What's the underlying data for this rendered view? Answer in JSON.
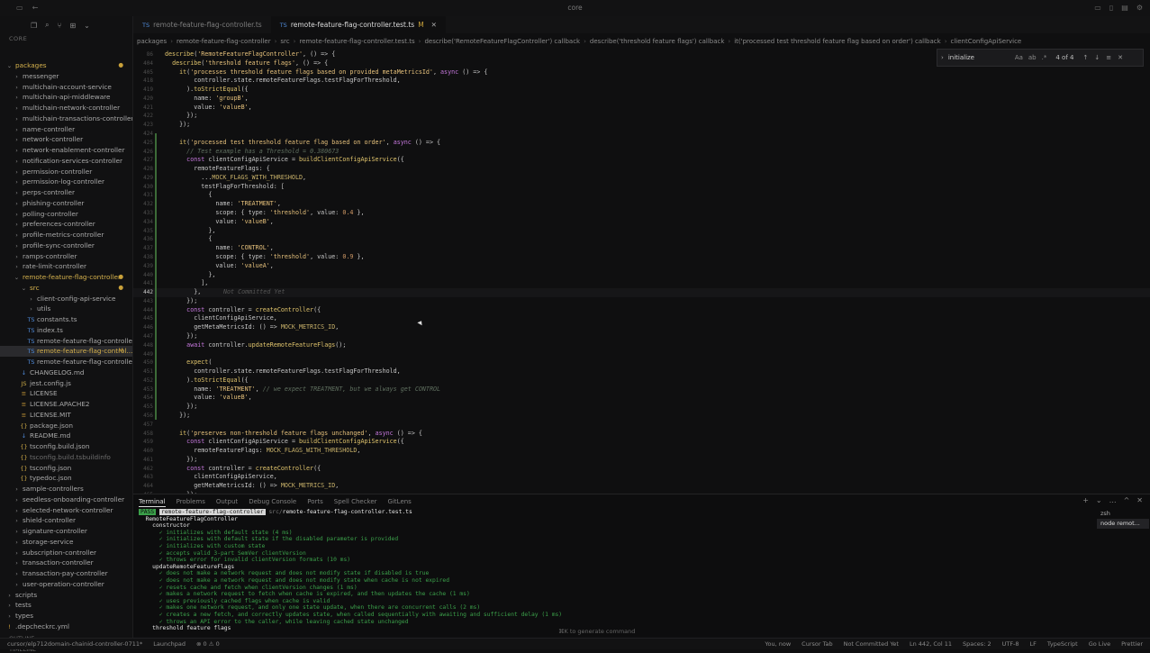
{
  "window": {
    "title": "core"
  },
  "sidebar": {
    "section_label": "CORE",
    "outline_label": "OUTLINE",
    "timeline_label": "TIMELINE",
    "items": [
      {
        "label": "packages",
        "depth": 0,
        "kind": "folder-open",
        "mod": true,
        "badge": "●"
      },
      {
        "label": "messenger",
        "depth": 1,
        "kind": "folder",
        "mod": false
      },
      {
        "label": "multichain-account-service",
        "depth": 1,
        "kind": "folder",
        "mod": false
      },
      {
        "label": "multichain-api-middleware",
        "depth": 1,
        "kind": "folder",
        "mod": false
      },
      {
        "label": "multichain-network-controller",
        "depth": 1,
        "kind": "folder",
        "mod": false
      },
      {
        "label": "multichain-transactions-controller",
        "depth": 1,
        "kind": "folder",
        "mod": false
      },
      {
        "label": "name-controller",
        "depth": 1,
        "kind": "folder",
        "mod": false
      },
      {
        "label": "network-controller",
        "depth": 1,
        "kind": "folder",
        "mod": false
      },
      {
        "label": "network-enablement-controller",
        "depth": 1,
        "kind": "folder",
        "mod": false
      },
      {
        "label": "notification-services-controller",
        "depth": 1,
        "kind": "folder",
        "mod": false
      },
      {
        "label": "permission-controller",
        "depth": 1,
        "kind": "folder",
        "mod": false
      },
      {
        "label": "permission-log-controller",
        "depth": 1,
        "kind": "folder",
        "mod": false
      },
      {
        "label": "perps-controller",
        "depth": 1,
        "kind": "folder",
        "mod": false
      },
      {
        "label": "phishing-controller",
        "depth": 1,
        "kind": "folder",
        "mod": false
      },
      {
        "label": "polling-controller",
        "depth": 1,
        "kind": "folder",
        "mod": false
      },
      {
        "label": "preferences-controller",
        "depth": 1,
        "kind": "folder",
        "mod": false
      },
      {
        "label": "profile-metrics-controller",
        "depth": 1,
        "kind": "folder",
        "mod": false
      },
      {
        "label": "profile-sync-controller",
        "depth": 1,
        "kind": "folder",
        "mod": false
      },
      {
        "label": "ramps-controller",
        "depth": 1,
        "kind": "folder",
        "mod": false
      },
      {
        "label": "rate-limit-controller",
        "depth": 1,
        "kind": "folder",
        "mod": false
      },
      {
        "label": "remote-feature-flag-controller",
        "depth": 1,
        "kind": "folder-open",
        "mod": true,
        "badge": "●"
      },
      {
        "label": "src",
        "depth": 2,
        "kind": "folder-open",
        "mod": true,
        "badge": "●"
      },
      {
        "label": "client-config-api-service",
        "depth": 3,
        "kind": "folder",
        "mod": false
      },
      {
        "label": "utils",
        "depth": 3,
        "kind": "folder",
        "mod": false
      },
      {
        "label": "constants.ts",
        "depth": 3,
        "kind": "ts",
        "mod": false
      },
      {
        "label": "index.ts",
        "depth": 3,
        "kind": "ts",
        "mod": false
      },
      {
        "label": "remote-feature-flag-controller-ty...",
        "depth": 3,
        "kind": "ts",
        "mod": false
      },
      {
        "label": "remote-feature-flag-control...",
        "depth": 3,
        "kind": "ts",
        "mod": true,
        "selected": true,
        "badge": "M"
      },
      {
        "label": "remote-feature-flag-controller.ts",
        "depth": 3,
        "kind": "ts",
        "mod": false
      },
      {
        "label": "CHANGELOG.md",
        "depth": 2,
        "kind": "md",
        "mod": false
      },
      {
        "label": "jest.config.js",
        "depth": 2,
        "kind": "js",
        "mod": false
      },
      {
        "label": "LICENSE",
        "depth": 2,
        "kind": "lic",
        "mod": false
      },
      {
        "label": "LICENSE.APACHE2",
        "depth": 2,
        "kind": "lic",
        "mod": false
      },
      {
        "label": "LICENSE.MIT",
        "depth": 2,
        "kind": "lic",
        "mod": false
      },
      {
        "label": "package.json",
        "depth": 2,
        "kind": "json",
        "mod": false
      },
      {
        "label": "README.md",
        "depth": 2,
        "kind": "md",
        "mod": false
      },
      {
        "label": "tsconfig.build.json",
        "depth": 2,
        "kind": "json",
        "mod": false
      },
      {
        "label": "tsconfig.build.tsbuildinfo",
        "depth": 2,
        "kind": "json",
        "mod": false,
        "dim": true
      },
      {
        "label": "tsconfig.json",
        "depth": 2,
        "kind": "json",
        "mod": false
      },
      {
        "label": "typedoc.json",
        "depth": 2,
        "kind": "json",
        "mod": false
      },
      {
        "label": "sample-controllers",
        "depth": 1,
        "kind": "folder",
        "mod": false
      },
      {
        "label": "seedless-onboarding-controller",
        "depth": 1,
        "kind": "folder",
        "mod": false
      },
      {
        "label": "selected-network-controller",
        "depth": 1,
        "kind": "folder",
        "mod": false
      },
      {
        "label": "shield-controller",
        "depth": 1,
        "kind": "folder",
        "mod": false
      },
      {
        "label": "signature-controller",
        "depth": 1,
        "kind": "folder",
        "mod": false
      },
      {
        "label": "storage-service",
        "depth": 1,
        "kind": "folder",
        "mod": false
      },
      {
        "label": "subscription-controller",
        "depth": 1,
        "kind": "folder",
        "mod": false
      },
      {
        "label": "transaction-controller",
        "depth": 1,
        "kind": "folder",
        "mod": false
      },
      {
        "label": "transaction-pay-controller",
        "depth": 1,
        "kind": "folder",
        "mod": false
      },
      {
        "label": "user-operation-controller",
        "depth": 1,
        "kind": "folder",
        "mod": false
      },
      {
        "label": "scripts",
        "depth": 0,
        "kind": "folder",
        "mod": false
      },
      {
        "label": "tests",
        "depth": 0,
        "kind": "folder",
        "mod": false
      },
      {
        "label": "types",
        "depth": 0,
        "kind": "folder",
        "mod": false
      },
      {
        "label": ".depcheckrc.yml",
        "depth": 0,
        "kind": "yml",
        "mod": false
      }
    ]
  },
  "tabs": [
    {
      "label": "remote-feature-flag-controller.ts",
      "active": false,
      "mark": ""
    },
    {
      "label": "remote-feature-flag-controller.test.ts",
      "active": true,
      "mark": "M"
    }
  ],
  "breadcrumb": [
    "packages",
    "remote-feature-flag-controller",
    "src",
    "remote-feature-flag-controller.test.ts",
    "describe('RemoteFeatureFlagController') callback",
    "describe('threshold feature flags') callback",
    "it('processed test threshold feature flag based on order') callback",
    "clientConfigApiService"
  ],
  "find": {
    "query": "initialize",
    "count": "4 of 4",
    "case_label": "Aa"
  },
  "editor": {
    "current_line": "442",
    "ghost_text": "Not Committed Yet",
    "lines": [
      {
        "n": "86",
        "t": "describe('RemoteFeatureFlagController', () => {"
      },
      {
        "n": "404",
        "t": "  describe('threshold feature flags', () => {"
      },
      {
        "n": "405",
        "t": "    it('processes threshold feature flags based on provided metaMetricsId', async () => {"
      },
      {
        "n": "418",
        "t": "        controller.state.remoteFeatureFlags.testFlagForThreshold,"
      },
      {
        "n": "419",
        "t": "      ).toStrictEqual({"
      },
      {
        "n": "420",
        "t": "        name: 'groupB',"
      },
      {
        "n": "421",
        "t": "        value: 'valueB',"
      },
      {
        "n": "422",
        "t": "      });"
      },
      {
        "n": "423",
        "t": "    });"
      },
      {
        "n": "424",
        "t": ""
      },
      {
        "n": "425",
        "t": "    it('processed test threshold feature flag based on order', async () => {"
      },
      {
        "n": "426",
        "t": "      // Test example has a Threshold = 0.380673"
      },
      {
        "n": "427",
        "t": "      const clientConfigApiService = buildClientConfigApiService({"
      },
      {
        "n": "428",
        "t": "        remoteFeatureFlags: {"
      },
      {
        "n": "429",
        "t": "          ...MOCK_FLAGS_WITH_THRESHOLD,"
      },
      {
        "n": "430",
        "t": "          testFlagForThreshold: ["
      },
      {
        "n": "431",
        "t": "            {"
      },
      {
        "n": "432",
        "t": "              name: 'TREATMENT',"
      },
      {
        "n": "433",
        "t": "              scope: { type: 'threshold', value: 0.4 },"
      },
      {
        "n": "434",
        "t": "              value: 'valueB',"
      },
      {
        "n": "435",
        "t": "            },"
      },
      {
        "n": "436",
        "t": "            {"
      },
      {
        "n": "437",
        "t": "              name: 'CONTROL',"
      },
      {
        "n": "438",
        "t": "              scope: { type: 'threshold', value: 0.9 },"
      },
      {
        "n": "439",
        "t": "              value: 'valueA',"
      },
      {
        "n": "440",
        "t": "            },"
      },
      {
        "n": "441",
        "t": "          ],"
      },
      {
        "n": "442",
        "t": "        },"
      },
      {
        "n": "443",
        "t": "      });"
      },
      {
        "n": "444",
        "t": "      const controller = createController({"
      },
      {
        "n": "445",
        "t": "        clientConfigApiService,"
      },
      {
        "n": "446",
        "t": "        getMetaMetricsId: () => MOCK_METRICS_ID,"
      },
      {
        "n": "447",
        "t": "      });"
      },
      {
        "n": "448",
        "t": "      await controller.updateRemoteFeatureFlags();"
      },
      {
        "n": "449",
        "t": ""
      },
      {
        "n": "450",
        "t": "      expect("
      },
      {
        "n": "451",
        "t": "        controller.state.remoteFeatureFlags.testFlagForThreshold,"
      },
      {
        "n": "452",
        "t": "      ).toStrictEqual({"
      },
      {
        "n": "453",
        "t": "        name: 'TREATMENT', // we expect TREATMENT, but we always get CONTROL"
      },
      {
        "n": "454",
        "t": "        value: 'valueB',"
      },
      {
        "n": "455",
        "t": "      });"
      },
      {
        "n": "456",
        "t": "    });"
      },
      {
        "n": "457",
        "t": ""
      },
      {
        "n": "458",
        "t": "    it('preserves non-threshold feature flags unchanged', async () => {"
      },
      {
        "n": "459",
        "t": "      const clientConfigApiService = buildClientConfigApiService({"
      },
      {
        "n": "460",
        "t": "        remoteFeatureFlags: MOCK_FLAGS_WITH_THRESHOLD,"
      },
      {
        "n": "461",
        "t": "      });"
      },
      {
        "n": "462",
        "t": "      const controller = createController({"
      },
      {
        "n": "463",
        "t": "        clientConfigApiService,"
      },
      {
        "n": "464",
        "t": "        getMetaMetricsId: () => MOCK_METRICS_ID,"
      },
      {
        "n": "465",
        "t": "      });"
      },
      {
        "n": "466",
        "t": "      await controller.updateRemoteFeatureFlags();"
      }
    ]
  },
  "panel": {
    "tabs": [
      "Terminal",
      "Problems",
      "Output",
      "Debug Console",
      "Ports",
      "Spell Checker",
      "GitLens"
    ],
    "active_tab": "Terminal",
    "terminals": [
      "zsh",
      "node remot..."
    ],
    "pass_label": "PASS",
    "pass_pkg": "remote-feature-flag-controller",
    "pass_path_prefix": "src/",
    "pass_file": "remote-feature-flag-controller.test.ts",
    "lines": [
      {
        "t": "  RemoteFeatureFlagController",
        "cls": "bold"
      },
      {
        "t": "    constructor",
        "cls": "bold"
      },
      {
        "t": "      ✓ initializes with default state (4 ms)",
        "cls": "ok"
      },
      {
        "t": "      ✓ initializes with default state if the disabled parameter is provided",
        "cls": "ok"
      },
      {
        "t": "      ✓ initializes with custom state",
        "cls": "ok"
      },
      {
        "t": "      ✓ accepts valid 3-part SemVer clientVersion",
        "cls": "ok"
      },
      {
        "t": "      ✓ throws error for invalid clientVersion formats (10 ms)",
        "cls": "ok"
      },
      {
        "t": "    updateRemoteFeatureFlags",
        "cls": "bold"
      },
      {
        "t": "      ✓ does not make a network request and does not modify state if disabled is true",
        "cls": "ok"
      },
      {
        "t": "      ✓ does not make a network request and does not modify state when cache is not expired",
        "cls": "ok"
      },
      {
        "t": "      ✓ resets cache and fetch when clientVersion changes (1 ms)",
        "cls": "ok"
      },
      {
        "t": "      ✓ makes a network request to fetch when cache is expired, and then updates the cache (1 ms)",
        "cls": "ok"
      },
      {
        "t": "      ✓ uses previously cached flags when cache is valid",
        "cls": "ok"
      },
      {
        "t": "      ✓ makes one network request, and only one state update, when there are concurrent calls (2 ms)",
        "cls": "ok"
      },
      {
        "t": "      ✓ creates a new fetch, and correctly updates state, when called sequentially with awaiting and sufficient delay (1 ms)",
        "cls": "ok"
      },
      {
        "t": "      ✓ throws an API error to the caller, while leaving cached state unchanged",
        "cls": "ok"
      },
      {
        "t": "    threshold feature flags",
        "cls": "bold"
      }
    ]
  },
  "status": {
    "branch": "cursor/elp712domain-chainid-controller-0711*",
    "launchpad": "Launchpad",
    "problems": "⊗ 0 ⚠ 0",
    "hint": "⌘K to generate command",
    "you_now": "You, now",
    "cursor_tab": "Cursor Tab",
    "not_committed": "Not Committed Yet",
    "position": "Ln 442, Col 11",
    "spaces": "Spaces: 2",
    "encoding": "UTF-8",
    "eol": "LF",
    "language": "TypeScript",
    "golive": "Go Live",
    "prettier": "Prettier"
  }
}
